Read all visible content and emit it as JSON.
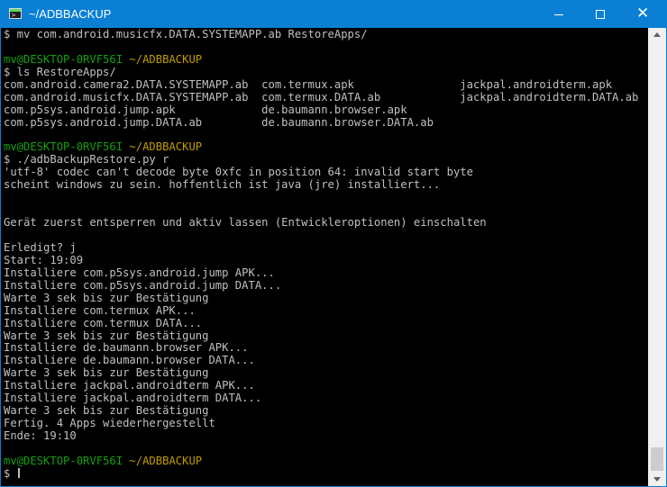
{
  "window": {
    "title": "~/ADBBACKUP",
    "icon": "terminal-app-icon",
    "icon_prompt": ">_",
    "controls": {
      "minimize": "minimize-icon",
      "maximize": "maximize-icon",
      "close": "close-icon",
      "close_glyph": "✕"
    },
    "accent_color": "#0a7fd4"
  },
  "terminal": {
    "colors": {
      "text": "#c0c0c0",
      "user_host": "#13a10e",
      "path": "#c19c00",
      "background": "#000000"
    },
    "lines": [
      {
        "text": "$ mv com.android.musicfx.DATA.SYSTEMAPP.ab RestoreApps/"
      },
      {
        "text": ""
      },
      {
        "prompt": {
          "user": "mv@DESKTOP-0RVF56I",
          "path": "~/ADBBACKUP"
        }
      },
      {
        "text": "$ ls RestoreApps/"
      },
      {
        "text": "com.android.camera2.DATA.SYSTEMAPP.ab  com.termux.apk                jackpal.androidterm.apk"
      },
      {
        "text": "com.android.musicfx.DATA.SYSTEMAPP.ab  com.termux.DATA.ab            jackpal.androidterm.DATA.ab"
      },
      {
        "text": "com.p5sys.android.jump.apk             de.baumann.browser.apk"
      },
      {
        "text": "com.p5sys.android.jump.DATA.ab         de.baumann.browser.DATA.ab"
      },
      {
        "text": ""
      },
      {
        "prompt": {
          "user": "mv@DESKTOP-0RVF56I",
          "path": "~/ADBBACKUP"
        }
      },
      {
        "text": "$ ./adbBackupRestore.py r"
      },
      {
        "text": "'utf-8' codec can't decode byte 0xfc in position 64: invalid start byte"
      },
      {
        "text": "scheint windows zu sein. hoffentlich ist java (jre) installiert..."
      },
      {
        "text": ""
      },
      {
        "text": ""
      },
      {
        "text": "Gerät zuerst entsperren und aktiv lassen (Entwickleroptionen) einschalten"
      },
      {
        "text": ""
      },
      {
        "text": "Erledigt? j"
      },
      {
        "text": "Start: 19:09"
      },
      {
        "text": "Installiere com.p5sys.android.jump APK..."
      },
      {
        "text": "Installiere com.p5sys.android.jump DATA..."
      },
      {
        "text": "Warte 3 sek bis zur Bestätigung"
      },
      {
        "text": "Installiere com.termux APK..."
      },
      {
        "text": "Installiere com.termux DATA..."
      },
      {
        "text": "Warte 3 sek bis zur Bestätigung"
      },
      {
        "text": "Installiere de.baumann.browser APK..."
      },
      {
        "text": "Installiere de.baumann.browser DATA..."
      },
      {
        "text": "Warte 3 sek bis zur Bestätigung"
      },
      {
        "text": "Installiere jackpal.androidterm APK..."
      },
      {
        "text": "Installiere jackpal.androidterm DATA..."
      },
      {
        "text": "Warte 3 sek bis zur Bestätigung"
      },
      {
        "text": "Fertig. 4 Apps wiederhergestellt"
      },
      {
        "text": "Ende: 19:10"
      },
      {
        "text": ""
      },
      {
        "prompt": {
          "user": "mv@DESKTOP-0RVF56I",
          "path": "~/ADBBACKUP"
        }
      },
      {
        "text": "$ ",
        "cursor": true
      }
    ]
  },
  "scrollbar": {
    "up_icon": "scroll-up-arrow-icon",
    "down_icon": "scroll-down-arrow-icon"
  }
}
